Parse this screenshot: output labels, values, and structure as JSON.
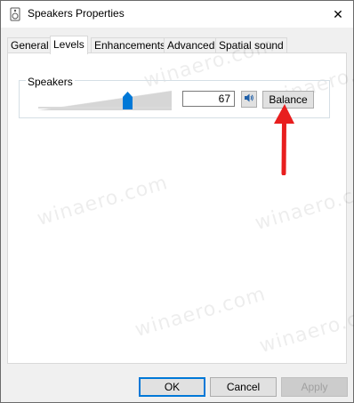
{
  "window": {
    "title": "Speakers Properties",
    "title_icon": "speaker-icon",
    "close_glyph": "✕"
  },
  "tabs": [
    {
      "label": "General",
      "active": false
    },
    {
      "label": "Levels",
      "active": true
    },
    {
      "label": "Enhancements",
      "active": false
    },
    {
      "label": "Advanced",
      "active": false
    },
    {
      "label": "Spatial sound",
      "active": false
    }
  ],
  "levels": {
    "group_label": "Speakers",
    "volume": "67",
    "volume_fraction": 0.67,
    "mute_icon": "speaker-volume-icon",
    "balance_label": "Balance"
  },
  "watermark": "winaero.com",
  "buttons": {
    "ok": "OK",
    "cancel": "Cancel",
    "apply": "Apply"
  },
  "colors": {
    "accent": "#0078d7",
    "annotation_arrow": "#e81e1e"
  }
}
